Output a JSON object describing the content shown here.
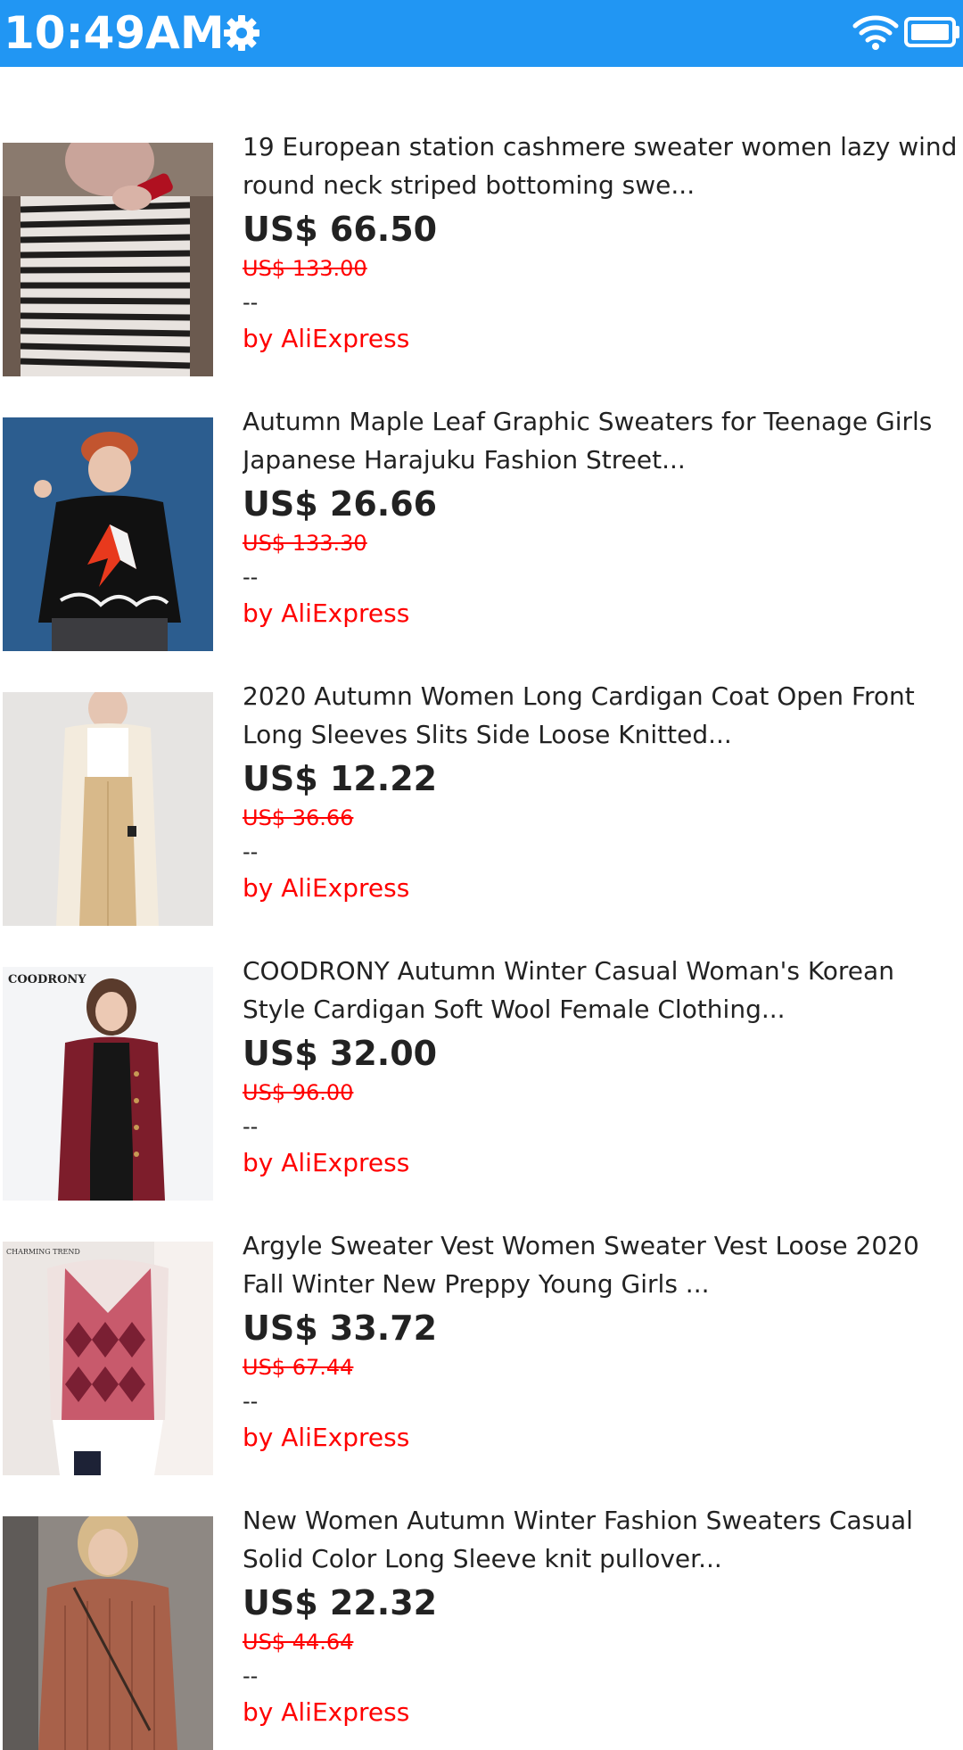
{
  "status_bar": {
    "time": "10:49AM",
    "icons": [
      "gear-icon",
      "wifi-icon",
      "battery-icon"
    ],
    "color": "#2196f3"
  },
  "products": [
    {
      "title": "19 European station cashmere sweater women lazy wind round neck striped bottoming swe...",
      "price": "US$ 66.50",
      "original_price": "US$ 133.00",
      "rating": "--",
      "seller": "by AliExpress"
    },
    {
      "title": "Autumn Maple Leaf Graphic Sweaters for Teenage Girls Japanese Harajuku Fashion Street...",
      "price": "US$ 26.66",
      "original_price": "US$ 133.30",
      "rating": "--",
      "seller": "by AliExpress"
    },
    {
      "title": "2020 Autumn Women Long Cardigan Coat Open Front Long Sleeves Slits Side Loose Knitted...",
      "price": "US$ 12.22",
      "original_price": "US$ 36.66",
      "rating": "--",
      "seller": "by AliExpress"
    },
    {
      "title": "COODRONY Autumn Winter Casual Woman's Korean Style Cardigan Soft Wool Female Clothing...",
      "price": "US$ 32.00",
      "original_price": "US$ 96.00",
      "rating": "--",
      "seller": "by AliExpress",
      "image_text": "COODRONY"
    },
    {
      "title": "Argyle Sweater Vest Women Sweater Vest Loose 2020 Fall Winter New Preppy Young Girls ...",
      "price": "US$ 33.72",
      "original_price": "US$ 67.44",
      "rating": "--",
      "seller": "by AliExpress",
      "image_text": "CHARMING TREND"
    },
    {
      "title": "New Women Autumn Winter Fashion Sweaters Casual Solid Color Long Sleeve knit pullover...",
      "price": "US$ 22.32",
      "original_price": "US$ 44.64",
      "rating": "--",
      "seller": "by AliExpress"
    }
  ]
}
